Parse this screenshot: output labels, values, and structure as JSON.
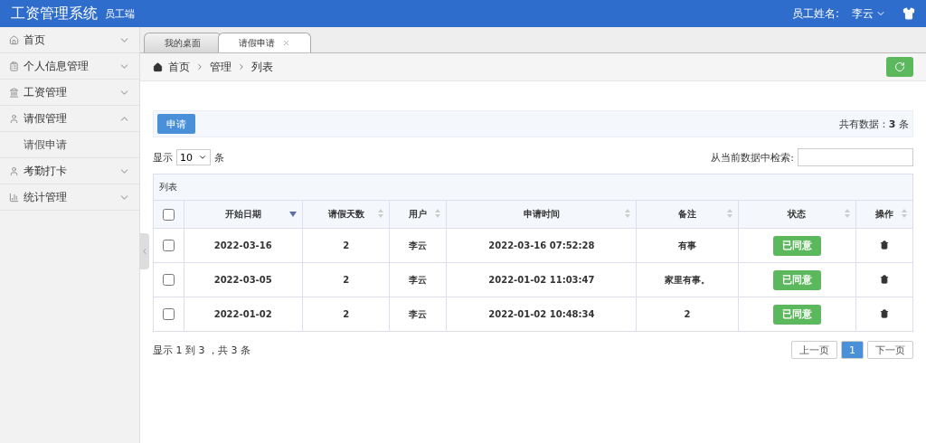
{
  "header": {
    "title": "工资管理系统",
    "subtitle": "员工端",
    "user_label": "员工姓名:",
    "user_name": "李云"
  },
  "sidebar": {
    "items": [
      {
        "label": "首页",
        "expanded": false
      },
      {
        "label": "个人信息管理",
        "expanded": false
      },
      {
        "label": "工资管理",
        "expanded": false
      },
      {
        "label": "请假管理",
        "expanded": true,
        "children": [
          {
            "label": "请假申请"
          }
        ]
      },
      {
        "label": "考勤打卡",
        "expanded": false
      },
      {
        "label": "统计管理",
        "expanded": false
      }
    ]
  },
  "tabs": [
    {
      "label": "我的桌面",
      "selected": false,
      "closable": false
    },
    {
      "label": "请假申请",
      "selected": true,
      "closable": true
    }
  ],
  "breadcrumb": [
    "首页",
    "管理",
    "列表"
  ],
  "toolbar": {
    "apply_button": "申请",
    "total": "共有数据：**3** 条"
  },
  "length": {
    "show_label": "显示",
    "page_size": "10",
    "unit": "条"
  },
  "search": {
    "label": "从当前数据中检索:"
  },
  "table": {
    "caption": "列表",
    "select_all_checked": false,
    "columns": [
      {
        "label": "开始日期",
        "sorted": true
      },
      {
        "label": "请假天数",
        "sorted": false
      },
      {
        "label": "用户",
        "sorted": false
      },
      {
        "label": "申请时间",
        "sorted": false
      },
      {
        "label": "备注",
        "sorted": false
      },
      {
        "label": "状态",
        "sorted": false
      },
      {
        "label": "操作",
        "sorted": false
      }
    ],
    "rows": [
      {
        "checked": false,
        "cells": [
          "2022-03-16",
          "2",
          "李云",
          "2022-03-16 07:52:28",
          "有事"
        ],
        "status": "已同意"
      },
      {
        "checked": false,
        "cells": [
          "2022-03-05",
          "2",
          "李云",
          "2022-01-02 11:03:47",
          "家里有事。"
        ],
        "status": "已同意"
      },
      {
        "checked": false,
        "cells": [
          "2022-01-02",
          "2",
          "李云",
          "2022-01-02 10:48:34",
          "2"
        ],
        "status": "已同意"
      }
    ]
  },
  "info": "显示 1 到 3 ，共 3 条",
  "pagination": {
    "prev": "上一页",
    "pages": [
      {
        "label": "1",
        "selected": true
      }
    ],
    "next": "下一页"
  }
}
